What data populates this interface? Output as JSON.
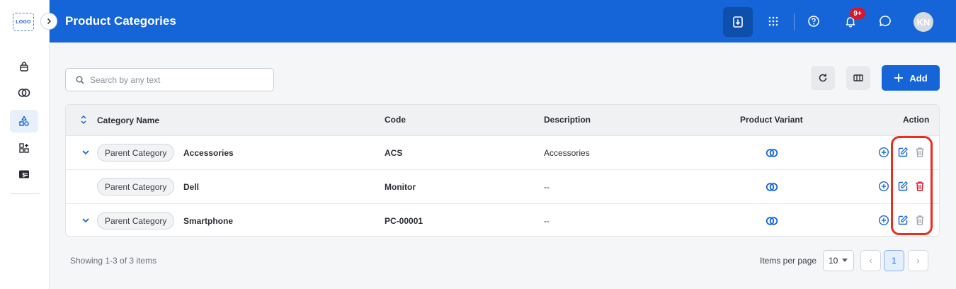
{
  "app": {
    "logo_text": "LOGO",
    "title": "Product Categories"
  },
  "header": {
    "notification_badge": "9+",
    "avatar_initials": "KN"
  },
  "sidebar": {
    "items": [
      {
        "icon": "bag-icon",
        "active": false
      },
      {
        "icon": "variant-rings-icon",
        "active": false
      },
      {
        "icon": "shapes-category-icon",
        "active": true
      },
      {
        "icon": "widget-add-icon",
        "active": false
      },
      {
        "icon": "price-tag-icon",
        "active": false
      }
    ]
  },
  "toolbar": {
    "search_placeholder": "Search by any text",
    "add_label": "Add"
  },
  "table": {
    "columns": {
      "name": "Category Name",
      "code": "Code",
      "description": "Description",
      "variant": "Product Variant",
      "action": "Action"
    },
    "rows": [
      {
        "tag": "Parent Category",
        "name": "Accessories",
        "code": "ACS",
        "description": "Accessories",
        "expandable": true
      },
      {
        "tag": "Parent Category",
        "name": "Dell",
        "code": "Monitor",
        "description": "--",
        "expandable": false
      },
      {
        "tag": "Parent Category",
        "name": "Smartphone",
        "code": "PC-00001",
        "description": "--",
        "expandable": true
      }
    ]
  },
  "colors": {
    "primary": "#1565d8",
    "danger": "#d8162c",
    "highlight": "#ee2b1d"
  },
  "footer": {
    "showing": "Showing 1-3 of 3 items",
    "items_per_page_label": "Items per page",
    "items_per_page_value": "10",
    "prev": "‹",
    "current_page": "1",
    "next": "›"
  }
}
